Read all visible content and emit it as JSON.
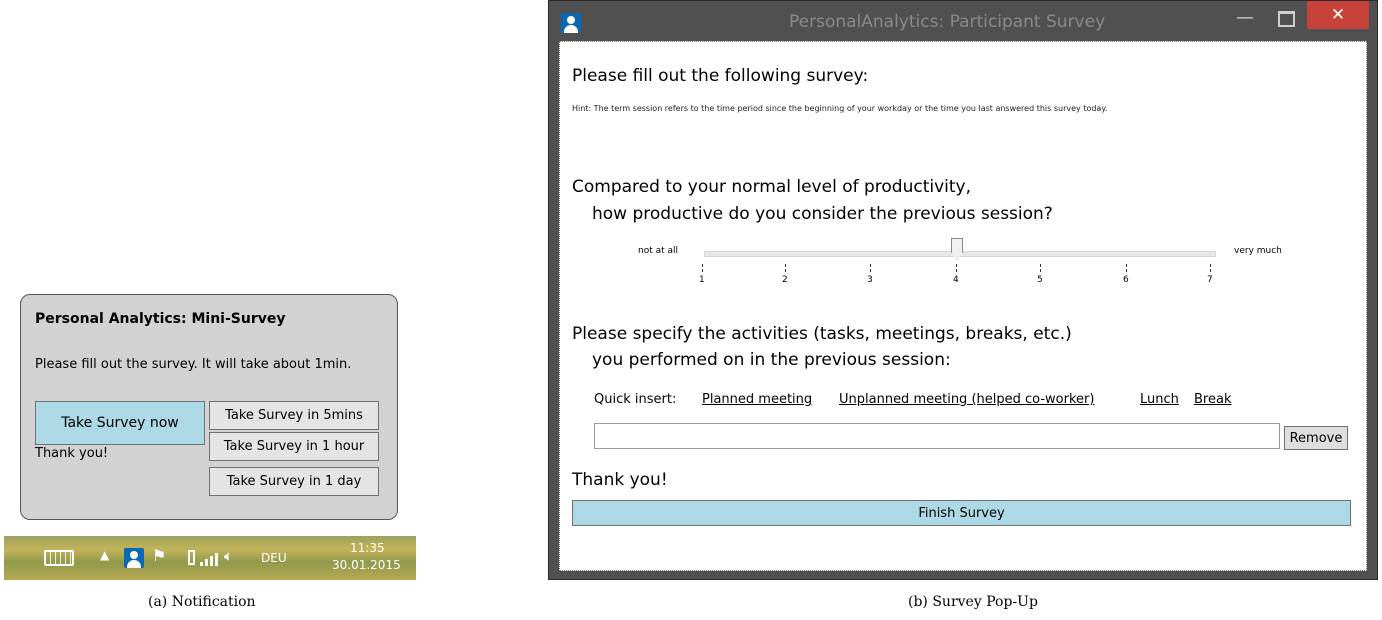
{
  "notification": {
    "title": "Personal Analytics: Mini-Survey",
    "message": "Please fill out the survey. It will take about 1min.",
    "buttons": {
      "take_now": "Take Survey now",
      "in_5mins": "Take Survey in 5mins",
      "in_1hour": "Take Survey in 1 hour",
      "in_1day": "Take Survey in 1 day"
    },
    "thanks": "Thank you!"
  },
  "taskbar": {
    "language": "DEU",
    "time": "11:35",
    "date": "30.01.2015",
    "icons": [
      "keyboard-icon",
      "show-hidden-icons-icon",
      "personal-analytics-icon",
      "flag-icon",
      "power-icon",
      "signal-icon",
      "speaker-icon"
    ]
  },
  "captions": {
    "a": "(a) Notification",
    "b": "(b) Survey Pop-Up"
  },
  "window": {
    "title": "PersonalAnalytics: Participant Survey",
    "controls": {
      "minimize": "—",
      "close": "✕"
    },
    "heading": "Please fill out the following survey:",
    "hint": "Hint: The term session refers to the time period since the beginning of your workday or the time you last answered this survey today.",
    "question1_line1": "Compared to your normal level of productivity,",
    "question1_line2": "how productive do you consider the previous session?",
    "slider": {
      "low_label": "not at all",
      "high_label": "very much",
      "ticks": [
        "1",
        "2",
        "3",
        "4",
        "5",
        "6",
        "7"
      ],
      "value": 4
    },
    "question2_line1": "Please specify the activities (tasks, meetings, breaks, etc.)",
    "question2_line2": "you performed on in the previous session:",
    "quick_insert_label": "Quick insert:",
    "quick_insert_links": [
      "Planned meeting",
      "Unplanned meeting (helped co-worker)",
      "Lunch",
      "Break"
    ],
    "activity_input_value": "",
    "remove_label": "Remove",
    "thanks": "Thank you!",
    "finish_label": "Finish Survey"
  },
  "colors": {
    "accent_button": "#add8e6",
    "close_button": "#c7423a",
    "notification_bg": "#d2d2d2",
    "window_frame": "#505050"
  }
}
